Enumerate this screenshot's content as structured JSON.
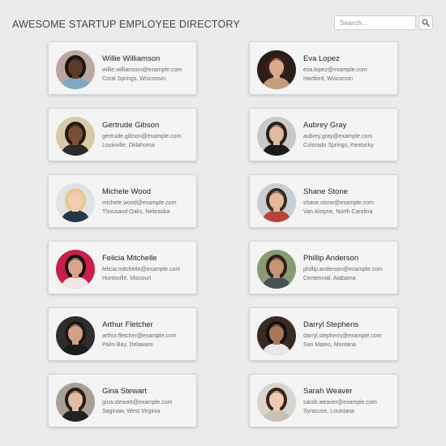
{
  "header": {
    "title": "AWESOME STARTUP EMPLOYEE DIRECTORY",
    "search_placeholder": "Search...",
    "search_value": "",
    "search_icon": "search-icon"
  },
  "employees": [
    {
      "name": "Willie Williamson",
      "email": "willie.williamson@example.com",
      "location": "Coral Springs, Wisconsin",
      "avatar_colors": {
        "bg": "#b9a7a0",
        "skin": "#5b3a2a",
        "hair": "#1c1410",
        "shirt": "#7fa7c0"
      }
    },
    {
      "name": "Eva Lopez",
      "email": "eva.lopez@example.com",
      "location": "Hartford, Wisconsin",
      "avatar_colors": {
        "bg": "#2a1d1a",
        "skin": "#d8a98c",
        "hair": "#3b1f18",
        "shirt": "#c49c7e"
      }
    },
    {
      "name": "Gertrude Gibson",
      "email": "gertrude.gibson@example.com",
      "location": "Louisville, Oklahoma",
      "avatar_colors": {
        "bg": "#d9c9a8",
        "skin": "#7a4e34",
        "hair": "#241812",
        "shirt": "#2d2a27"
      }
    },
    {
      "name": "Aubrey Gray",
      "email": "aubrey.gray@example.com",
      "location": "Colorado Springs, Kentucky",
      "avatar_colors": {
        "bg": "#c9c9c9",
        "skin": "#e0b9a0",
        "hair": "#2a1e19",
        "shirt": "#1a1a1a"
      }
    },
    {
      "name": "Michele Wood",
      "email": "michele.wood@example.com",
      "location": "Thousand Oaks, Nebraska",
      "avatar_colors": {
        "bg": "#dfe3e6",
        "skin": "#f0cdb4",
        "hair": "#e8c98a",
        "shirt": "#27374a"
      }
    },
    {
      "name": "Shane Stone",
      "email": "shane.stone@example.com",
      "location": "Van Alstyne, North Carolina",
      "avatar_colors": {
        "bg": "#c7cfd3",
        "skin": "#e5b89a",
        "hair": "#3a2a20",
        "shirt": "#b8433b"
      }
    },
    {
      "name": "Felicia Mitchelle",
      "email": "felicia.mitchelle@example.com",
      "location": "Huntsville, Missouri",
      "avatar_colors": {
        "bg": "#c8204a",
        "skin": "#d9a58a",
        "hair": "#1a1210",
        "shirt": "#f0e6e6"
      }
    },
    {
      "name": "Phillip Anderson",
      "email": "phillip.anderson@example.com",
      "location": "Centennial, Alabama",
      "avatar_colors": {
        "bg": "#8a9a72",
        "skin": "#c89478",
        "hair": "#2b211b",
        "shirt": "#4a4f55"
      }
    },
    {
      "name": "Arthur Fletcher",
      "email": "arthur.fletcher@example.com",
      "location": "Palm Bay, Delaware",
      "avatar_colors": {
        "bg": "#2e2e2e",
        "skin": "#cfa286",
        "hair": "#1e1712",
        "shirt": "#1b1b1b"
      }
    },
    {
      "name": "Darryl Stephens",
      "email": "darryl.stephens@example.com",
      "location": "San Mateo, Montana",
      "avatar_colors": {
        "bg": "#3a2a24",
        "skin": "#a87858",
        "hair": "#151010",
        "shirt": "#e8e8e8"
      }
    },
    {
      "name": "Gina Stewart",
      "email": "gina.stewart@example.com",
      "location": "Saginaw, West Virginia",
      "avatar_colors": {
        "bg": "#a8a098",
        "skin": "#e3bca4",
        "hair": "#2a1a16",
        "shirt": "#222222"
      }
    },
    {
      "name": "Sarah Weaver",
      "email": "sarah.weaver@example.com",
      "location": "Syracuse, Louisiana",
      "avatar_colors": {
        "bg": "#d8d4d0",
        "skin": "#efc9b2",
        "hair": "#3a2218",
        "shirt": "#c9c1b6"
      }
    }
  ]
}
